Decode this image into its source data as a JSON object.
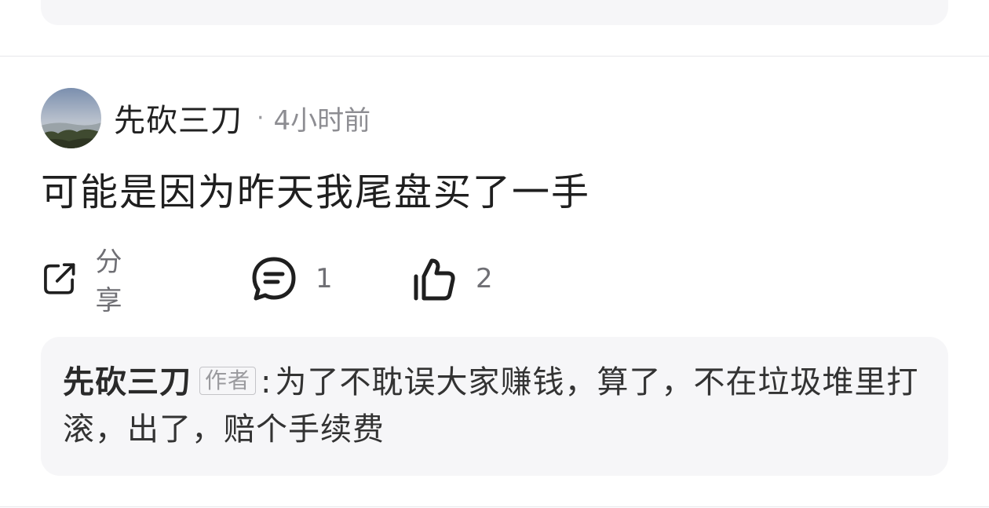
{
  "comment": {
    "author": "先砍三刀",
    "separator": "·",
    "time": "4小时前",
    "content": "可能是因为昨天我尾盘买了一手"
  },
  "actions": {
    "share_label": "分享",
    "comment_count": "1",
    "like_count": "2",
    "share_icon": "share-icon",
    "comment_icon": "comment-icon",
    "like_icon": "thumbs-up-icon"
  },
  "reply": {
    "author": "先砍三刀",
    "badge": "作者",
    "colon": ":",
    "text": "为了不耽误大家赚钱，算了，不在垃圾堆里打滚，出了，赔个手续费"
  },
  "colors": {
    "card_background": "#f6f6f8",
    "divider": "#e6e6ea",
    "secondary_text": "#8d8d92"
  }
}
